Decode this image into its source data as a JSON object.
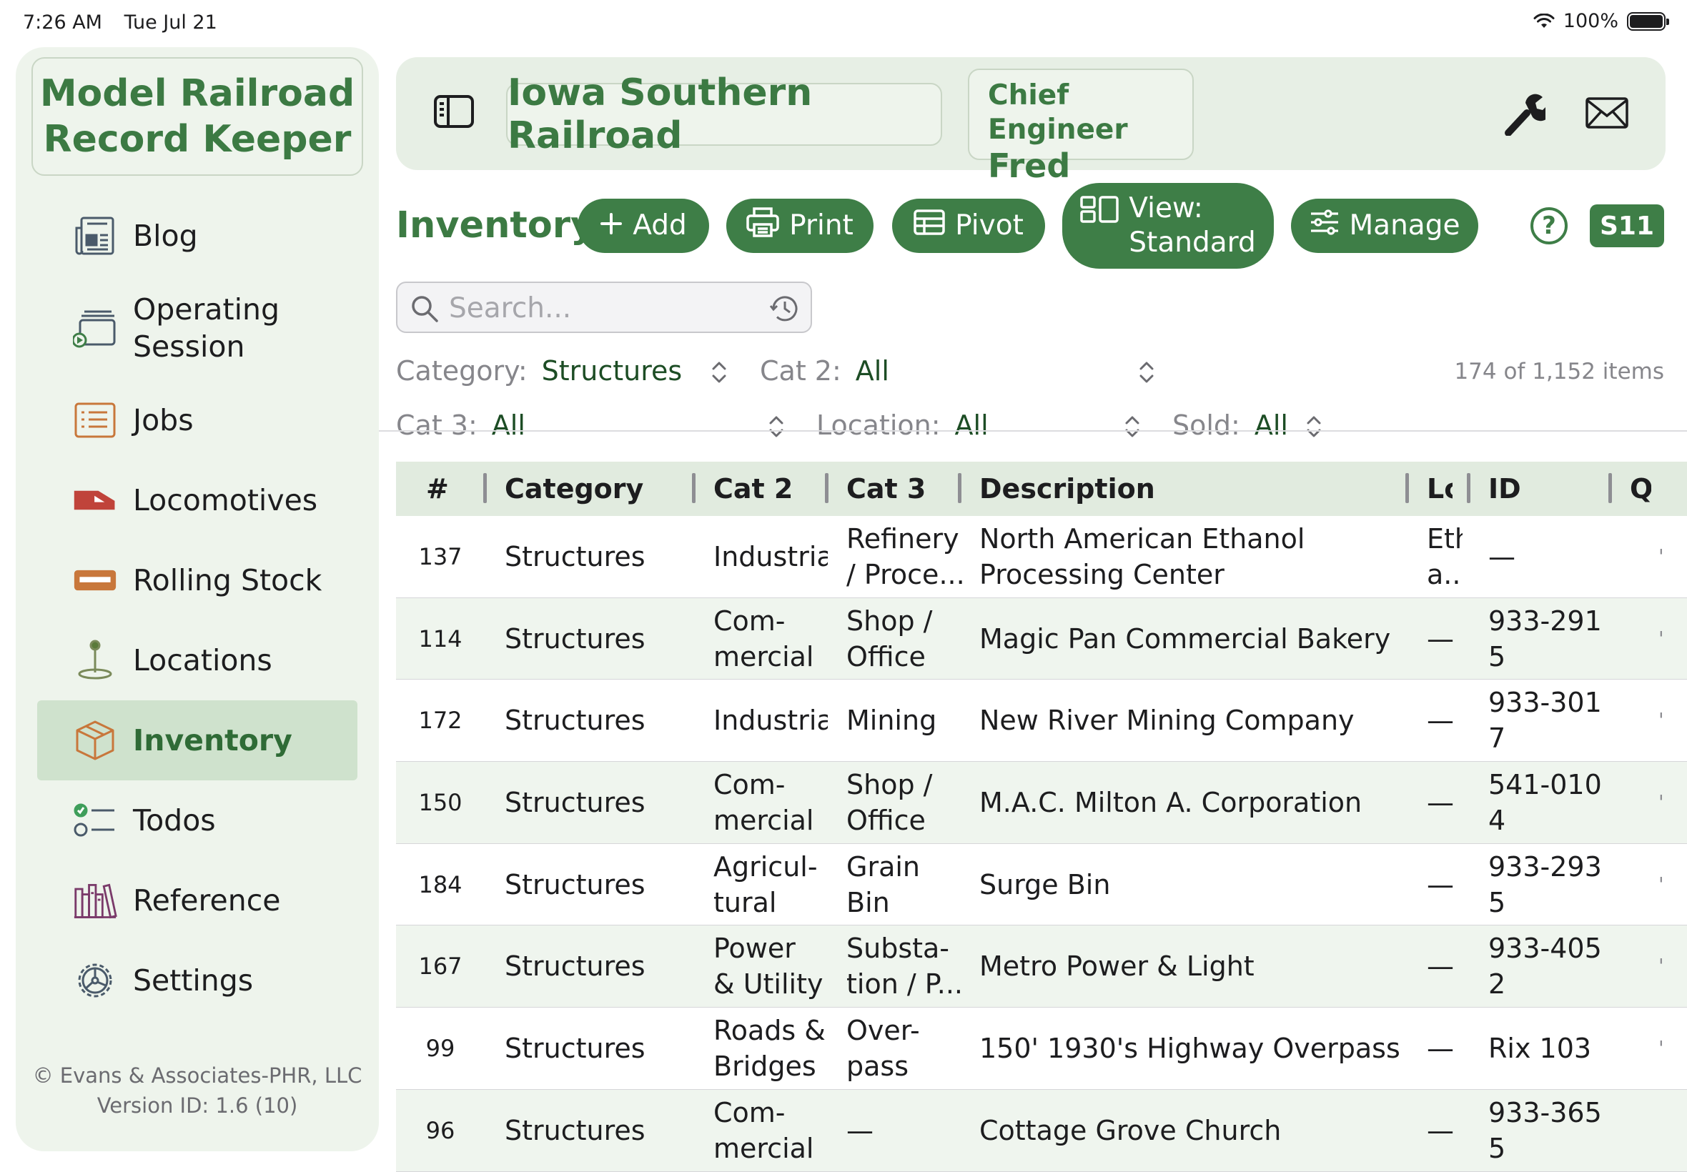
{
  "status_bar": {
    "time": "7:26 AM",
    "date": "Tue Jul 21",
    "battery": "100%"
  },
  "sidebar": {
    "app_title": "Model Railroad\nRecord Keeper",
    "items": [
      {
        "label": "Blog",
        "icon": "newspaper-icon"
      },
      {
        "label": "Operating\nSession",
        "icon": "operating-session-icon"
      },
      {
        "label": "Jobs",
        "icon": "list-icon"
      },
      {
        "label": "Locomotives",
        "icon": "locomotive-icon"
      },
      {
        "label": "Rolling Stock",
        "icon": "rolling-stock-icon"
      },
      {
        "label": "Locations",
        "icon": "location-pin-icon"
      },
      {
        "label": "Inventory",
        "icon": "box-icon",
        "active": true
      },
      {
        "label": "Todos",
        "icon": "checklist-icon"
      },
      {
        "label": "Reference",
        "icon": "books-icon"
      },
      {
        "label": "Settings",
        "icon": "gear-icon"
      }
    ],
    "copyright": "© Evans & Associates-PHR, LLC\nVersion ID: 1.6 (10)"
  },
  "header": {
    "railroad": "Iowa Southern Railroad",
    "role": "Chief Engineer",
    "user": "Fred"
  },
  "toolbar": {
    "title": "Inventory",
    "add": "Add",
    "print": "Print",
    "pivot": "Pivot",
    "view": "View:\nStandard",
    "manage": "Manage",
    "help": "?",
    "s11": "S11"
  },
  "search": {
    "placeholder": "Search..."
  },
  "filters": {
    "category_label": "Category:",
    "category_value": "Structures",
    "cat2_label": "Cat 2:",
    "cat2_value": "All",
    "cat3_label": "Cat 3:",
    "cat3_value": "All",
    "location_label": "Location:",
    "location_value": "All",
    "sold_label": "Sold:",
    "sold_value": "All",
    "count": "174 of 1,152 items"
  },
  "table": {
    "columns": [
      "#",
      "Category",
      "Cat 2",
      "Cat 3",
      "Description",
      "Lc",
      "ID",
      "Q"
    ],
    "rows": [
      {
        "num": "137",
        "category": "Structures",
        "cat2": "Industrial",
        "cat3": "Refinery\n/ Proce...",
        "description": "North American Ethanol\nProcessing Center",
        "loc": "Eth\na...",
        "id": "—"
      },
      {
        "num": "114",
        "category": "Structures",
        "cat2": "Com-\nmercial",
        "cat3": "Shop /\nOffice",
        "description": "Magic Pan Commercial Bakery",
        "loc": "—",
        "id": "933-291\n5"
      },
      {
        "num": "172",
        "category": "Structures",
        "cat2": "Industrial",
        "cat3": "Mining",
        "description": "New River Mining Company",
        "loc": "—",
        "id": "933-301\n7"
      },
      {
        "num": "150",
        "category": "Structures",
        "cat2": "Com-\nmercial",
        "cat3": "Shop /\nOffice",
        "description": "M.A.C. Milton A. Corporation",
        "loc": "—",
        "id": "541-010\n4"
      },
      {
        "num": "184",
        "category": "Structures",
        "cat2": "Agricul-\ntural",
        "cat3": "Grain Bin",
        "description": "Surge Bin",
        "loc": "—",
        "id": "933-293\n5"
      },
      {
        "num": "167",
        "category": "Structures",
        "cat2": "Power\n& Utility",
        "cat3": "Substa-\ntion / P...",
        "description": "Metro Power & Light",
        "loc": "—",
        "id": "933-405\n2"
      },
      {
        "num": "99",
        "category": "Structures",
        "cat2": "Roads &\nBridges",
        "cat3": "Over-\npass",
        "description": "150' 1930's Highway Overpass",
        "loc": "—",
        "id": "Rix 103"
      },
      {
        "num": "96",
        "category": "Structures",
        "cat2": "Com-\nmercial",
        "cat3": "—",
        "description": "Cottage Grove Church",
        "loc": "—",
        "id": "933-365\n5"
      }
    ]
  },
  "colors": {
    "accent": "#3e7e47",
    "sidebar_bg": "#eef4ec",
    "header_bg": "#e7efe5",
    "row_alt": "#eff5ee",
    "active_nav": "#cfe2cd"
  }
}
